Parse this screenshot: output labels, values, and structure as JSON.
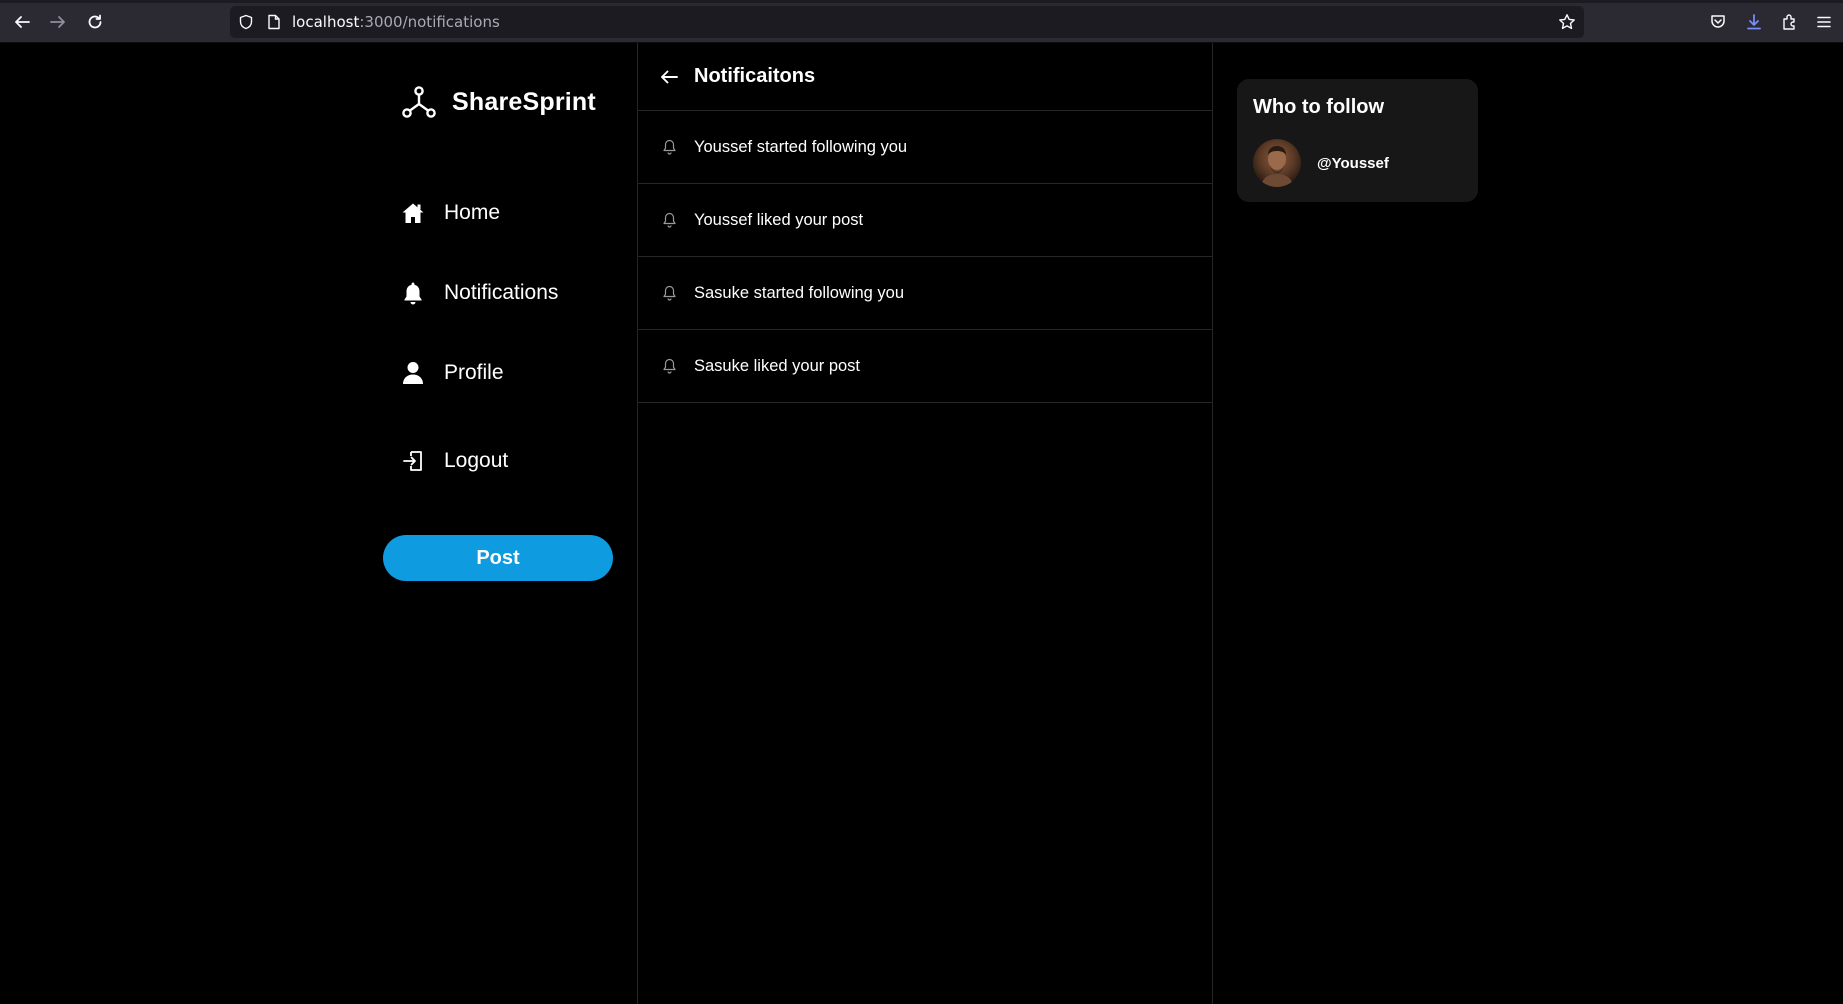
{
  "browser": {
    "url_host": "localhost",
    "url_path": ":3000/notifications"
  },
  "sidebar": {
    "brand": "ShareSprint",
    "items": [
      {
        "label": "Home",
        "icon": "home-icon"
      },
      {
        "label": "Notifications",
        "icon": "bell-icon"
      },
      {
        "label": "Profile",
        "icon": "user-icon"
      },
      {
        "label": "Logout",
        "icon": "logout-icon"
      }
    ],
    "post_label": "Post"
  },
  "main": {
    "title": "Notificaitons",
    "notifications": [
      {
        "text": "Youssef started following you"
      },
      {
        "text": "Youssef liked your post"
      },
      {
        "text": "Sasuke started following you"
      },
      {
        "text": "Sasuke liked your post"
      }
    ]
  },
  "who_to_follow": {
    "heading": "Who to follow",
    "users": [
      {
        "handle": "@Youssef"
      }
    ]
  },
  "colors": {
    "accent": "#0e9be0",
    "background": "#000000",
    "card": "#171717",
    "divider": "#262626"
  }
}
